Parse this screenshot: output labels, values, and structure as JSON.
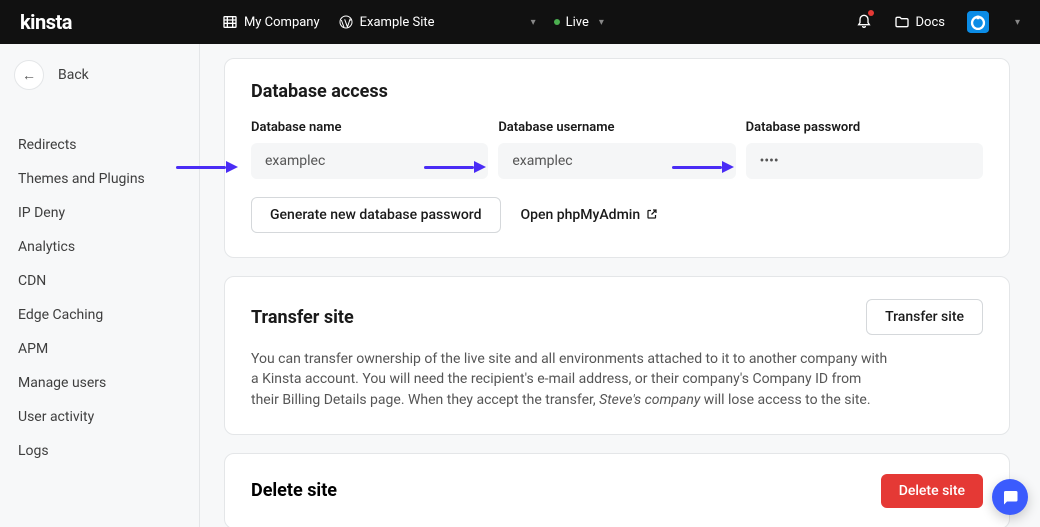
{
  "brand": "KINSTA",
  "topbar": {
    "company": "My Company",
    "site": "Example Site",
    "env": "Live",
    "docs": "Docs"
  },
  "sidebar": {
    "back": "Back",
    "items": [
      "Redirects",
      "Themes and Plugins",
      "IP Deny",
      "Analytics",
      "CDN",
      "Edge Caching",
      "APM",
      "Manage users",
      "User activity",
      "Logs"
    ]
  },
  "db": {
    "title": "Database access",
    "name_label": "Database name",
    "name_value": "examplec",
    "user_label": "Database username",
    "user_value": "examplec",
    "pass_label": "Database password",
    "pass_value": "••••",
    "gen_btn": "Generate new database password",
    "phpmyadmin": "Open phpMyAdmin"
  },
  "transfer": {
    "title": "Transfer site",
    "btn": "Transfer site",
    "desc1": "You can transfer ownership of the live site and all environments attached to it to another company with a Kinsta account. You will need the recipient's e-mail address, or their company's Company ID from their Billing Details page. When they accept the transfer, ",
    "desc_em": "Steve's company",
    "desc2": " will lose access to the site."
  },
  "delete": {
    "title": "Delete site",
    "btn": "Delete site"
  }
}
